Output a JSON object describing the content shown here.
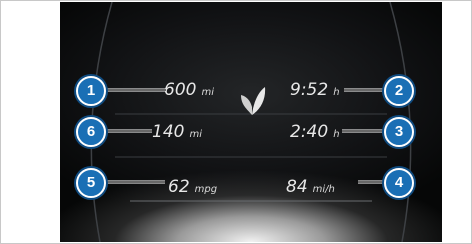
{
  "readings": {
    "r1": {
      "value": "600",
      "unit": "mi"
    },
    "r2": {
      "value": "9:52",
      "unit": "h"
    },
    "r3": {
      "value": "2:40",
      "unit": "h"
    },
    "r4": {
      "value": "84",
      "unit": "mi/h"
    },
    "r5": {
      "value": "62",
      "unit": "mpg"
    },
    "r6": {
      "value": "140",
      "unit": "mi"
    }
  },
  "callouts": [
    "1",
    "2",
    "3",
    "4",
    "5",
    "6"
  ],
  "icons": {
    "center": "eco-leaf-icon"
  },
  "colors": {
    "badge": "#1a6fb5",
    "screen": "#111214",
    "text": "#e7e7e7"
  }
}
